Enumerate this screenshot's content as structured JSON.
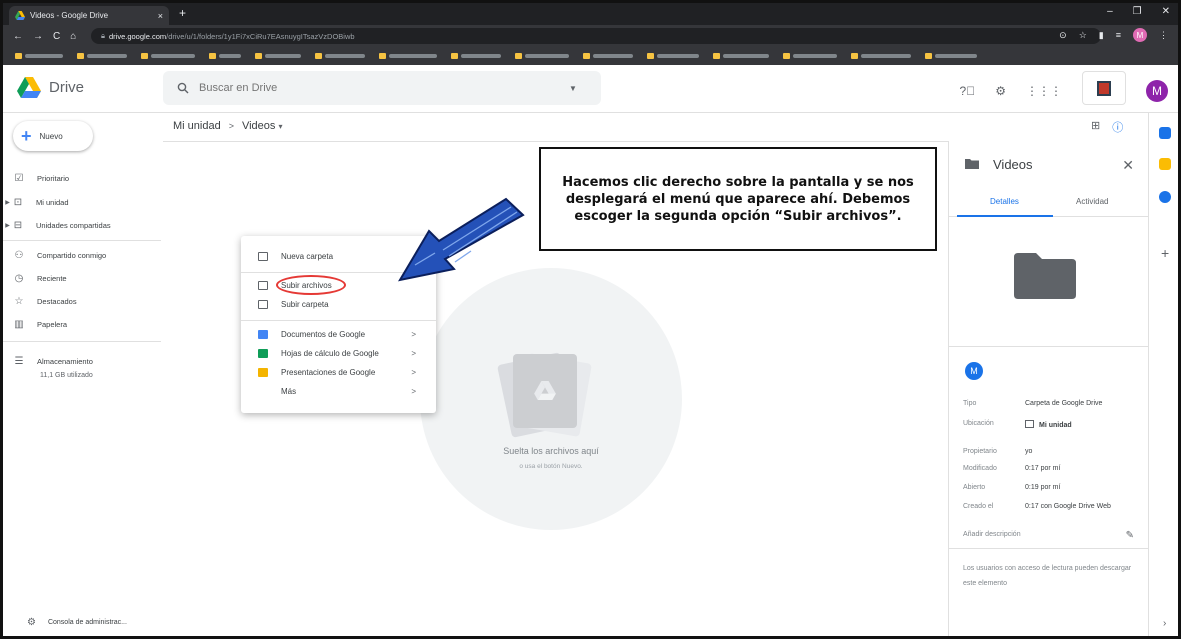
{
  "browser": {
    "tab_title": "Videos - Google Drive",
    "tab_close": "×",
    "new_tab": "+",
    "url_host": "drive.google.com",
    "url_path": "/drive/u/1/folders/1y1Fi7xCiRu7EAsnuygITsazVzDOBiwb",
    "nav_icons": [
      "arrow-left-icon",
      "arrow-right-icon",
      "reload-icon",
      "home-icon"
    ],
    "profile_letter": "M",
    "window_controls": [
      "–",
      "❐",
      "✕"
    ]
  },
  "header": {
    "app_name": "Drive",
    "search_placeholder": "Buscar en Drive",
    "avatar_letter": "M"
  },
  "sidebar": {
    "new_label": "Nuevo",
    "items": [
      {
        "label": "Prioritario",
        "icon": "priority-icon"
      },
      {
        "label": "Mi unidad",
        "icon": "my-drive-icon"
      },
      {
        "label": "Unidades compartidas",
        "icon": "shared-drives-icon"
      },
      {
        "label": "Compartido conmigo",
        "icon": "shared-with-me-icon"
      },
      {
        "label": "Reciente",
        "icon": "clock-icon"
      },
      {
        "label": "Destacados",
        "icon": "star-icon"
      },
      {
        "label": "Papelera",
        "icon": "trash-icon"
      },
      {
        "label": "Almacenamiento",
        "icon": "storage-icon"
      }
    ],
    "storage_used": "11,1 GB utilizado",
    "admin_console": "Consola de administrac..."
  },
  "breadcrumb": {
    "root": "Mi unidad",
    "separator": ">",
    "current": "Videos"
  },
  "dropzone": {
    "title": "Suelta los archivos aquí",
    "subtitle": "o usa el botón Nuevo."
  },
  "context_menu": {
    "items": [
      {
        "label": "Nueva carpeta",
        "icon": "new-folder-icon"
      },
      {
        "label": "Subir archivos",
        "icon": "upload-file-icon"
      },
      {
        "label": "Subir carpeta",
        "icon": "upload-folder-icon"
      },
      {
        "label": "Documentos de Google",
        "icon": "docs-icon",
        "color": "#4285f4"
      },
      {
        "label": "Hojas de cálculo de Google",
        "icon": "sheets-icon",
        "color": "#0f9d58"
      },
      {
        "label": "Presentaciones de Google",
        "icon": "slides-icon",
        "color": "#f4b400"
      },
      {
        "label": "Más"
      }
    ],
    "submenu_chevron": ">"
  },
  "annotation": {
    "text": "Hacemos clic derecho sobre la pantalla y se nos desplegará el menú que aparece ahí. Debemos escoger la segunda opción “Subir archivos”."
  },
  "details": {
    "title": "Videos",
    "tabs": [
      "Detalles",
      "Actividad"
    ],
    "owner_avatar": "M",
    "props": [
      {
        "key": "Tipo",
        "value": "Carpeta de Google Drive"
      },
      {
        "key": "Ubicación",
        "value": "Mi unidad"
      },
      {
        "key": "Propietario",
        "value": "yo"
      },
      {
        "key": "Modificado",
        "value": "0:17 por mí"
      },
      {
        "key": "Abierto",
        "value": "0:19 por mí"
      },
      {
        "key": "Creado el",
        "value": "0:17 con Google Drive Web"
      }
    ],
    "add_description": "Añadir descripción",
    "note": "Los usuarios con acceso de lectura pueden descargar este elemento"
  },
  "colors": {
    "accent": "#1a73e8",
    "highlight_oval": "#e53935",
    "arrow": "#2451b8",
    "avatar": "#8e24aa"
  }
}
